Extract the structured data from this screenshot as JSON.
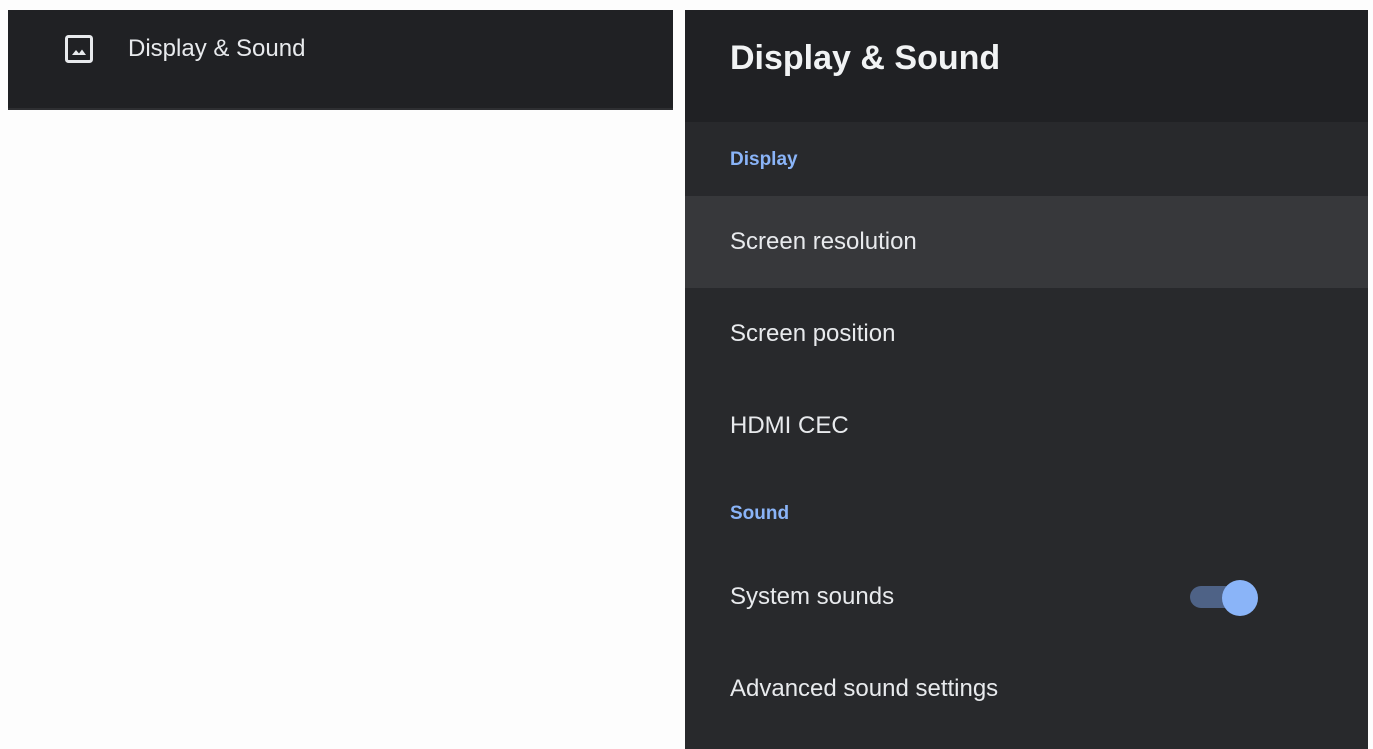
{
  "left_menu": {
    "selected_item": {
      "icon": "image-icon",
      "label": "Display & Sound"
    }
  },
  "panel": {
    "title": "Display & Sound",
    "sections": [
      {
        "header": "Display",
        "items": [
          {
            "label": "Screen resolution",
            "focused": true
          },
          {
            "label": "Screen position"
          },
          {
            "label": "HDMI CEC"
          }
        ]
      },
      {
        "header": "Sound",
        "items": [
          {
            "label": "System sounds",
            "toggle": true,
            "toggle_on": true
          },
          {
            "label": "Advanced sound settings"
          }
        ]
      }
    ]
  },
  "colors": {
    "accent": "#8ab4f8",
    "panel_bg": "#28292c",
    "header_bg": "#202124",
    "focused_row_bg": "#37383b"
  }
}
